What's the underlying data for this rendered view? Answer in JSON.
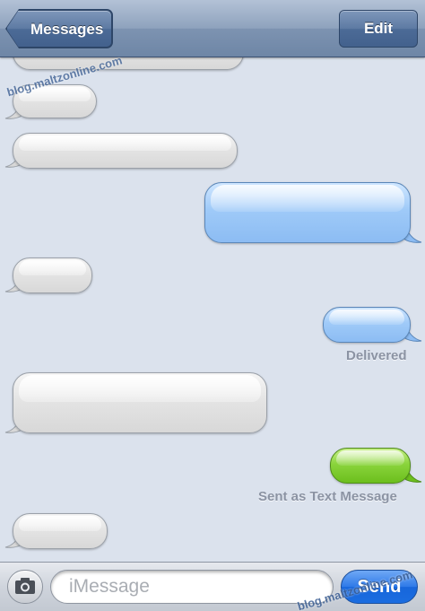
{
  "navbar": {
    "back_label": "Messages",
    "edit_label": "Edit",
    "watermark_top": "blog.maltzonline.com"
  },
  "messages": [
    {
      "side": "incoming",
      "color": "gray"
    },
    {
      "side": "incoming",
      "color": "gray"
    },
    {
      "side": "incoming",
      "color": "gray"
    },
    {
      "side": "outgoing",
      "color": "blue"
    },
    {
      "side": "incoming",
      "color": "gray"
    },
    {
      "side": "outgoing",
      "color": "blue",
      "status": "Delivered"
    },
    {
      "side": "incoming",
      "color": "gray"
    },
    {
      "side": "outgoing",
      "color": "green",
      "status": "Sent as Text Message"
    },
    {
      "side": "incoming",
      "color": "gray"
    }
  ],
  "status": {
    "delivered": "Delivered",
    "sent_as_text": "Sent as Text Message"
  },
  "composer": {
    "placeholder": "iMessage",
    "value": "",
    "send_label": "Send",
    "watermark_bottom": "blog.maltzonline.com"
  },
  "colors": {
    "imessage_blue": "#9fcaf8",
    "sms_green": "#8ad43c",
    "incoming_gray": "#e4e4e4",
    "background": "#dbe2ed",
    "send_blue": "#2f7ae8"
  },
  "icons": {
    "back": "chevron-left-icon",
    "camera": "camera-icon"
  }
}
